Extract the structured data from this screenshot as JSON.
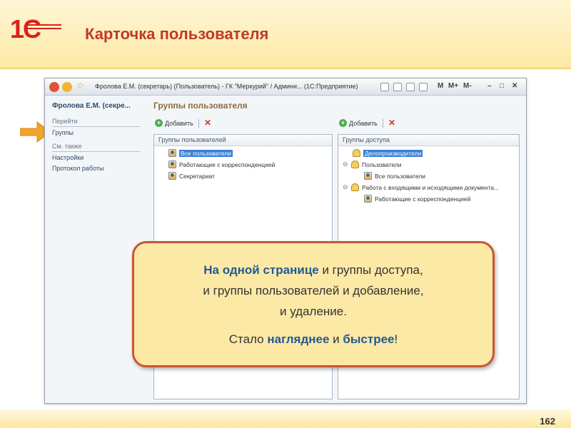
{
  "slide": {
    "logo_text": "1С",
    "title": "Карточка пользователя",
    "page_number": "162"
  },
  "window": {
    "title": "Фролова Е.М. (секретарь) (Пользователь) - ГК \"Меркурий\" / Админи... (1С:Предприятие)",
    "controls": [
      "M",
      "M+",
      "M-",
      "–",
      "□",
      "✕"
    ]
  },
  "nav": {
    "user": "Фролова Е.М. (секре...",
    "goto_header": "Перейти",
    "groups_link": "Группы",
    "see_also_header": "См. также",
    "settings_link": "Настройки",
    "protocol_link": "Протокол работы"
  },
  "content": {
    "title": "Группы пользователя",
    "left_panel": {
      "add_label": "Добавить",
      "header": "Группы пользователей",
      "items": [
        {
          "label": "Все пользователи",
          "selected": true
        },
        {
          "label": "Работающие с корреспонденцией",
          "selected": false
        },
        {
          "label": "Секретариат",
          "selected": false
        }
      ]
    },
    "right_panel": {
      "add_label": "Добавить",
      "header": "Группы доступа",
      "items": [
        {
          "label": "Делопроизводители",
          "selected": true
        },
        {
          "label": "Пользователи",
          "selected": false
        },
        {
          "label": "Все пользователи",
          "selected": false
        },
        {
          "label": "Работа с входящими и исходящими документа...",
          "selected": false
        },
        {
          "label": "Работающие с корреспонденцией",
          "selected": false
        }
      ]
    }
  },
  "callout": {
    "line1_a": "На одной странице",
    "line1_b": " и группы доступа,",
    "line2": "и группы пользователей и добавление,",
    "line3": "и удаление.",
    "line4_a": "Стало ",
    "line4_b": "нагляднее",
    "line4_c": " и ",
    "line4_d": "быстрее",
    "line4_e": "!"
  },
  "colors": {
    "brand_red": "#d8231a",
    "callout_border": "#c9562e",
    "callout_bg": "#fde9a6",
    "highlight": "#1f5a94",
    "arrow": "#f0a52a"
  }
}
